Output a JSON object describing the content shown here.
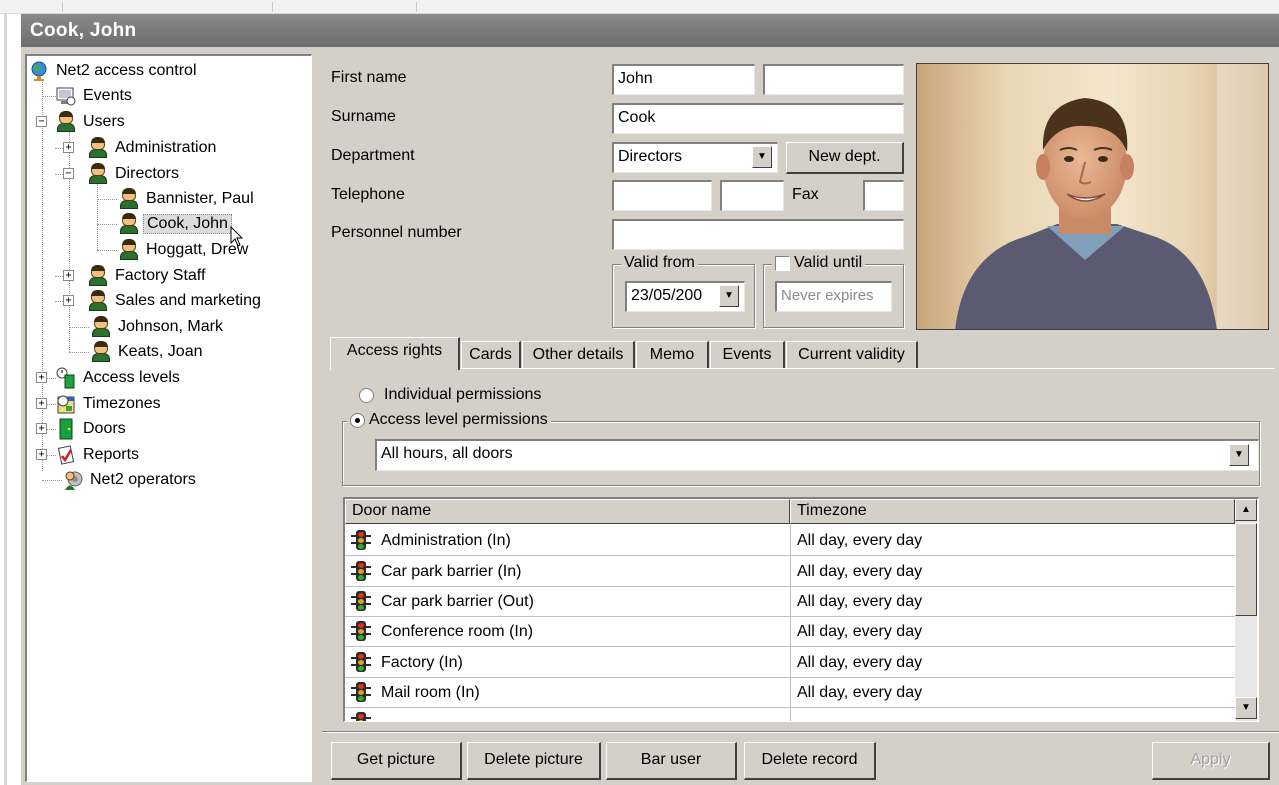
{
  "window": {
    "title": "Cook, John"
  },
  "tree": {
    "root": "Net2 access control",
    "events": "Events",
    "users": "Users",
    "administration": "Administration",
    "directors": "Directors",
    "bannister": "Bannister, Paul",
    "cook": "Cook, John",
    "hoggatt": "Hoggatt, Drew",
    "factory_staff": "Factory Staff",
    "sales": "Sales and marketing",
    "johnson": "Johnson, Mark",
    "keats": "Keats, Joan",
    "access_levels": "Access levels",
    "timezones": "Timezones",
    "doors": "Doors",
    "reports": "Reports",
    "operators": "Net2 operators"
  },
  "form": {
    "first_name_label": "First name",
    "first_name_value": "John",
    "first_name_extra_value": "",
    "surname_label": "Surname",
    "surname_value": "Cook",
    "department_label": "Department",
    "department_value": "Directors",
    "new_dept_button": "New dept.",
    "telephone_label": "Telephone",
    "telephone_value": "",
    "telephone_ext_value": "",
    "fax_label": "Fax",
    "fax_value": "",
    "personnel_label": "Personnel number",
    "personnel_value": "",
    "valid_from_label": "Valid from",
    "valid_from_value": "23/05/200",
    "valid_until_label": "Valid until",
    "valid_until_checked": false,
    "valid_until_value": "Never expires"
  },
  "tabs": {
    "access_rights": "Access rights",
    "cards": "Cards",
    "other_details": "Other details",
    "memo": "Memo",
    "events": "Events",
    "current_validity": "Current validity"
  },
  "access": {
    "individual_label": "Individual permissions",
    "level_label": "Access level permissions",
    "selected_option": "level",
    "level_value": "All hours, all doors"
  },
  "doors_table": {
    "columns": [
      "Door name",
      "Timezone"
    ],
    "rows": [
      {
        "door": "Administration (In)",
        "timezone": "All day, every day"
      },
      {
        "door": "Car park barrier (In)",
        "timezone": "All day, every day"
      },
      {
        "door": "Car park barrier (Out)",
        "timezone": "All day, every day"
      },
      {
        "door": "Conference room (In)",
        "timezone": "All day, every day"
      },
      {
        "door": "Factory (In)",
        "timezone": "All day, every day"
      },
      {
        "door": "Mail room (In)",
        "timezone": "All day, every day"
      }
    ]
  },
  "buttons": {
    "get_picture": "Get picture",
    "delete_picture": "Delete picture",
    "bar_user": "Bar user",
    "delete_record": "Delete record",
    "apply": "Apply"
  },
  "colors": {
    "title_bar": "#7b7b7b",
    "window_face": "#d4d0c8",
    "selection_bg": "#dcdcdc"
  }
}
